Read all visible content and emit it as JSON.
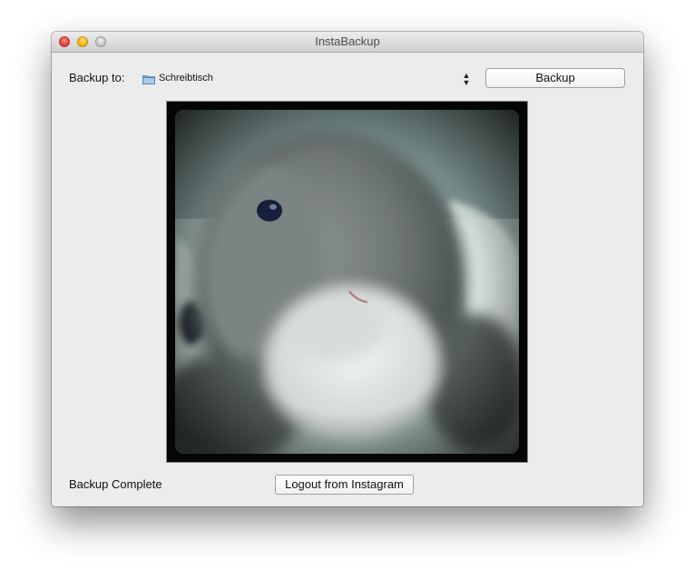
{
  "window": {
    "title": "InstaBackup"
  },
  "backup": {
    "to_label": "Backup to:",
    "destination": "Schreibtisch",
    "destination_icon": "folder-icon",
    "button_label": "Backup"
  },
  "photo": {
    "subject": "photo"
  },
  "status": {
    "text": "Backup Complete"
  },
  "logout": {
    "button_label": "Logout from Instagram"
  }
}
